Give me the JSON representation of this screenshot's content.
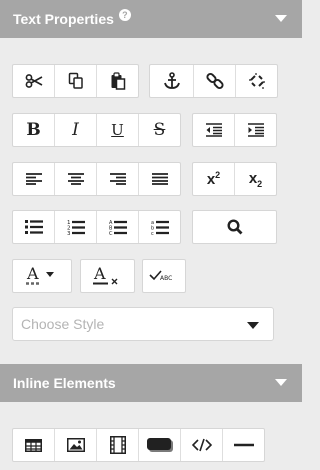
{
  "text_properties": {
    "title": "Text Properties",
    "help_glyph": "?",
    "headings_labels": {
      "sup": "2",
      "sub": "2",
      "abc": "ABC"
    },
    "format_buttons": {
      "bold": "B",
      "italic": "I",
      "underline": "U",
      "strike": "S"
    },
    "style_dropdown": {
      "placeholder": "Choose Style"
    }
  },
  "inline_elements": {
    "title": "Inline Elements"
  },
  "icons": [
    "scissors-icon",
    "copy-icon",
    "paste-icon",
    "anchor-icon",
    "link-icon",
    "unlink-icon",
    "bold-icon",
    "italic-icon",
    "underline-icon",
    "strikethrough-icon",
    "outdent-icon",
    "indent-icon",
    "align-left-icon",
    "align-center-icon",
    "align-right-icon",
    "justify-icon",
    "superscript-icon",
    "subscript-icon",
    "bulleted-list-icon",
    "numbered-list-icon",
    "lettered-list-icon",
    "roman-list-icon",
    "search-icon",
    "font-color-icon",
    "clear-formatting-icon",
    "spellcheck-icon",
    "table-icon",
    "image-icon",
    "video-icon",
    "button-icon",
    "code-icon",
    "horizontal-rule-icon"
  ],
  "colors": {
    "header": "#a6a6a6",
    "background": "#ececec",
    "button": "#ffffff"
  }
}
